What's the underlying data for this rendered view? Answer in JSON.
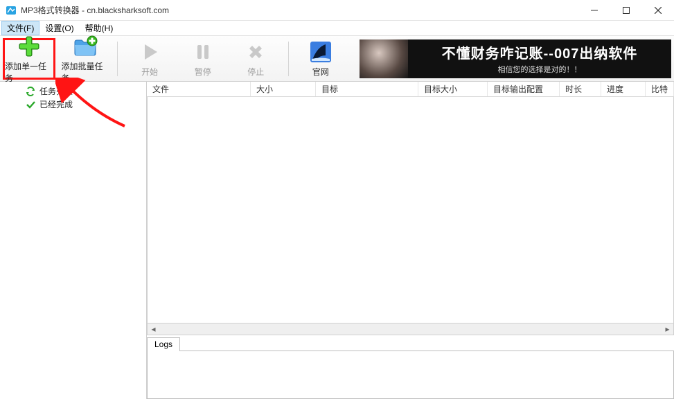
{
  "title": "MP3格式转换器 - cn.blacksharksoft.com",
  "menu": {
    "file": "文件(F)",
    "settings": "设置(O)",
    "help": "帮助(H)"
  },
  "toolbar": {
    "add_single": "添加单一任务",
    "add_batch": "添加批量任务",
    "start": "开始",
    "pause": "暂停",
    "stop": "停止",
    "website": "官网"
  },
  "banner": {
    "line1": "不懂财务咋记账--007出纳软件",
    "line2": "相信您的选择是对的！！"
  },
  "tree": {
    "task_list": "任务列表",
    "done": "已经完成"
  },
  "columns": {
    "file": "文件",
    "size": "大小",
    "target": "目标",
    "target_size": "目标大小",
    "target_cfg": "目标输出配置",
    "duration": "时长",
    "progress": "进度",
    "bitrate": "比特"
  },
  "logs_tab": "Logs"
}
